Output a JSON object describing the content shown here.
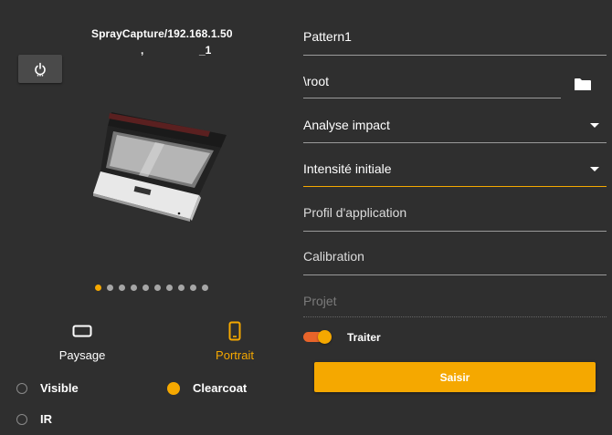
{
  "device": {
    "title": "SprayCapture/192.168.1.50",
    "subtitle_left": ",",
    "subtitle_right": "_1"
  },
  "carousel": {
    "count": 10,
    "active_index": 0
  },
  "orientation": {
    "paysage_label": "Paysage",
    "portrait_label": "Portrait",
    "selected": "Portrait"
  },
  "capture_mode": {
    "visible_label": "Visible",
    "clearcoat_label": "Clearcoat",
    "ir_label": "IR",
    "selected": "Clearcoat"
  },
  "form": {
    "pattern_name": "Pattern1",
    "path_value": "\\root",
    "analysis_label": "Analyse impact",
    "intensity_label": "Intensité initiale",
    "profile_label": "Profil d'application",
    "calibration_label": "Calibration",
    "project_placeholder": "Projet",
    "traiter_label": "Traiter",
    "traiter_on": true,
    "submit_label": "Saisir"
  },
  "colors": {
    "accent": "#f5a800",
    "toggle_track": "#e8642a",
    "background": "#2f2f2f"
  }
}
